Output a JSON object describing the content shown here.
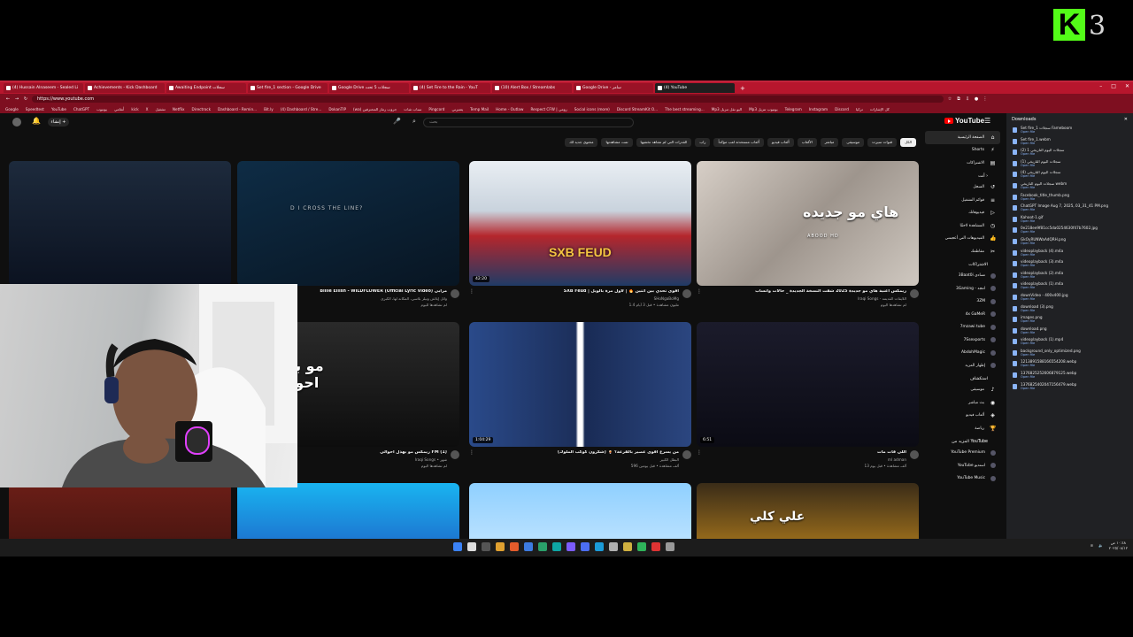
{
  "stream_logo": {
    "letter": "K",
    "number": "3"
  },
  "browser": {
    "tabs": [
      {
        "label": "(4) Hussain Alnaseem - Sealed Li"
      },
      {
        "label": "Achievements - Kick Dashboard"
      },
      {
        "label": "Awaiting Endpoint سجلات"
      },
      {
        "label": "Set fire_1 section - Google Drive"
      },
      {
        "label": "Google Drive سجلات 5 تحت"
      },
      {
        "label": "(4) Set Fire to the Rain - YouT"
      },
      {
        "label": "(10) Alert Box / Streamlabs"
      },
      {
        "label": "Google Drive - سامر"
      },
      {
        "label": "(4) YouTube",
        "active": true
      }
    ],
    "new_tab": "+",
    "window_controls": [
      "–",
      "□",
      "✕"
    ],
    "url": "https://www.youtube.com",
    "bookmarks": [
      "Google",
      "Speedtest",
      "YouTube",
      "ChatGPT",
      "يوتيوب",
      "أنغامي",
      "kick",
      "X",
      "تشغيل",
      "Netflix",
      "Directrock",
      "Dashboard - Remin...",
      "Bit.ly",
      "(4) Dashboard / Stre...",
      "DokanTIP",
      "(wa) جروب رماز المحترفين",
      "سناب شات",
      "Pingcord",
      "يعتبرني",
      "Temp Mail",
      "Home - Outlaw",
      "Respect CFW | رومي",
      "Social icons (more)",
      "Discord StreamKit O...",
      "The best streaming...",
      "Mp3 اليو نقل تنزيل",
      "Mp3 يوتيوب تنزيل",
      "Telegram",
      "Instagram",
      "Discord",
      "تركيا",
      "كل الإشارات"
    ]
  },
  "youtube": {
    "logo": "YouTube",
    "search_placeholder": "بحث",
    "create_label": "إنشاء",
    "chips": [
      "الكل",
      "قنوات سيرت",
      "موسيقى",
      "مباشر",
      "الألعاب",
      "ألعاب فيديو",
      "ألعاب مستحدثة لعب مؤكداً",
      "راب",
      "القدرات التي لم تشاهد تختفيها",
      "تمت مشاهدتها",
      "محتوى جديد لك"
    ],
    "sidebar": {
      "main": [
        {
          "label": "الصفحة الرئيسية",
          "icon": "⌂",
          "selected": true
        },
        {
          "label": "Shorts",
          "icon": "⚡"
        },
        {
          "label": "الاشتراكات",
          "icon": "▤"
        }
      ],
      "you_header": "أنت ›",
      "you": [
        {
          "label": "السجل",
          "icon": "↺"
        },
        {
          "label": "قوائم التشغيل",
          "icon": "≡"
        },
        {
          "label": "فيديوهاتك",
          "icon": "▷"
        },
        {
          "label": "المشاهدة لاحقًا",
          "icon": "◷"
        },
        {
          "label": "الفيديوهات التي أعجبتني",
          "icon": "👍"
        },
        {
          "label": "مقاطعك",
          "icon": "✂"
        }
      ],
      "subs_header": "الاشتراكات",
      "subs": [
        {
          "label": "3Baat0i تسادي"
        },
        {
          "label": "3Gaming - امجد"
        },
        {
          "label": "3ZM"
        },
        {
          "label": "4x GaMeR"
        },
        {
          "label": "7mzawi tube"
        },
        {
          "label": "7Ssexports"
        },
        {
          "label": "AbdohMagic"
        },
        {
          "label": "إظهار المزيد"
        }
      ],
      "explore_header": "استكشاف",
      "explore": [
        {
          "label": "موسيقى",
          "icon": "♪"
        },
        {
          "label": "بث مباشر",
          "icon": "◉"
        },
        {
          "label": "ألعاب فيديو",
          "icon": "◈"
        },
        {
          "label": "رياضة",
          "icon": "🏆"
        }
      ],
      "more_header": "المزيد من YouTube",
      "more": [
        {
          "label": "YouTube Premium"
        },
        {
          "label": "YouTube استديو"
        },
        {
          "label": "YouTube Music"
        }
      ]
    },
    "videos": [
      {
        "title": "Billie Eilish - WILDFLOWER (Official Lyric Video) مرابي",
        "channel": "وائل إيلاش ونيلز بلاسي، المكانة لها، الكبرى",
        "stats": "لم تشاهدها لليوم",
        "duration": "",
        "thumb_text": "D I CROSS THE LINE?"
      },
      {
        "title": "SXB Feud | أقوى تحدي بين اثنين 🔥 | لأول مرة بالويل",
        "channel": "SHoNgaBoMg",
        "stats": "1.4 مليون مشاهدة • قبل 3 أيام",
        "duration": "42:20",
        "thumb_text": "SXB FEUD"
      },
      {
        "title": "ريمكس اغنية هاي مو جديدة 2025 شفت النسخة الجديدة _ حالات واتساب",
        "channel": "Iraqi Songs - اللايقات القديمة",
        "stats": "لم تشاهدها اليوم",
        "duration": "",
        "thumb_text": "هاي مو جديده",
        "thumb_sub": "ABOOD HD"
      },
      {
        "title": "",
        "channel": "",
        "stats": "",
        "duration": "",
        "thumb_text": ""
      },
      {
        "title": "ريمكس مو بهذل احوالي FM (1)",
        "channel": "Iraqi Songs • شهر",
        "stats": "لم تشاهدها اليوم",
        "duration": "",
        "thumb_text": "مو بهذل احوالي"
      },
      {
        "title": "من يسرع اقوى عصير بالقرعة؟ 🍹 (شكرون كوكب الملوك)",
        "channel": "البطل الكبير",
        "stats": "596 ألف مشاهدة • قبل يومين",
        "duration": "1:04:29",
        "thumb_text": ""
      },
      {
        "title": "اللي فات مات",
        "channel": "ml adman",
        "stats": "13 ألف مشاهدة • قبل يوم",
        "duration": "6:51",
        "thumb_text": ""
      },
      {
        "title": "سيرت اليادو",
        "channel": "7SWEN",
        "stats": "38 ألف مشاهدة • قبل 5 ساعات",
        "duration": "8:57",
        "thumb_text": ""
      },
      {
        "title": "",
        "channel": "",
        "stats": "",
        "duration": "",
        "thumb_text": ""
      },
      {
        "title": "",
        "channel": "",
        "stats": "",
        "duration": "",
        "thumb_text": ""
      },
      {
        "title": "",
        "channel": "",
        "stats": "",
        "duration": "",
        "thumb_text": ""
      },
      {
        "title": "",
        "channel": "",
        "stats": "",
        "duration": "",
        "thumb_text": "علي كلي"
      }
    ]
  },
  "downloads": {
    "title": "Downloads",
    "open_label": "Open file",
    "items": [
      {
        "name": "Set fire_1 سجلات Fameboom"
      },
      {
        "name": "Set fire_1.webm"
      },
      {
        "name": "(2) سجلات اليوم التاريخي 1"
      },
      {
        "name": "(1) سجلات اليوم التاريخي"
      },
      {
        "name": "(4) سجلات اليوم التاريخي"
      },
      {
        "name": "سجلات اليوم التاريخي webm"
      },
      {
        "name": "Facebook_title_thumb.png"
      },
      {
        "name": "ChatGPT Image Aug 7, 2025, 03_31_41 PM.png"
      },
      {
        "name": "Kahoot-1.gif"
      },
      {
        "name": "0e218ee9f81cc5da0254630f47b7602.jpg"
      },
      {
        "name": "GkOyRUNWaAdQRH.png"
      },
      {
        "name": "videoplayback (4).m4a"
      },
      {
        "name": "videoplayback (3).m4a"
      },
      {
        "name": "videoplayback (2).m4a"
      },
      {
        "name": "videoplayback (1).m4a"
      },
      {
        "name": "downVideo - 400x400.jpg"
      },
      {
        "name": "download (3).png"
      },
      {
        "name": "images.png"
      },
      {
        "name": "download.png"
      },
      {
        "name": "videoplayback (1).mp4"
      },
      {
        "name": "background_only_optimized.png"
      },
      {
        "name": "1213891588166554208.webp"
      },
      {
        "name": "1376825252606879125.webp"
      },
      {
        "name": "1376825402047156479.webp"
      }
    ]
  },
  "taskbar": {
    "time": "١٠:٤٨ ص",
    "date": "٢٠٢٥/٠٨/١٢"
  },
  "colors": {
    "accent": "#b7162d",
    "kick_green": "#53fc18",
    "yt_red": "#ff0000"
  }
}
